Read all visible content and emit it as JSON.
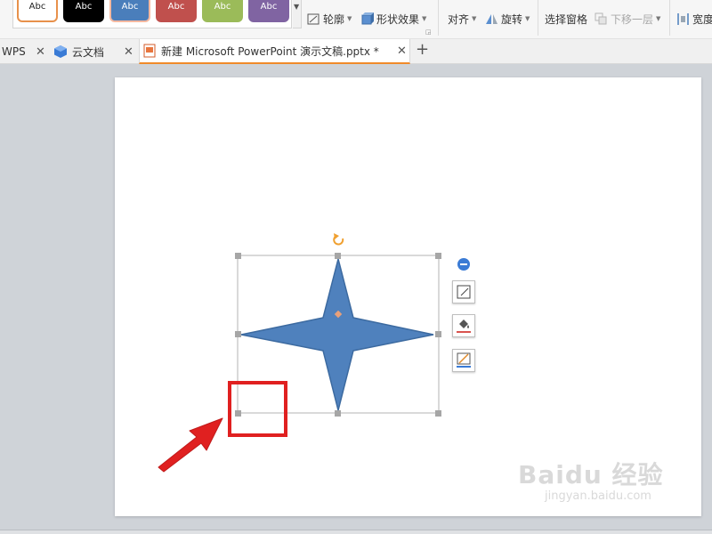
{
  "ribbon": {
    "style_presets": [
      {
        "label": "Abc",
        "color": "#ffffff"
      },
      {
        "label": "Abc",
        "color": "#000000"
      },
      {
        "label": "Abc",
        "color": "#4a7ebb"
      },
      {
        "label": "Abc",
        "color": "#c0504d"
      },
      {
        "label": "Abc",
        "color": "#9bbb59"
      },
      {
        "label": "Abc",
        "color": "#8064a2"
      }
    ],
    "outline_label": "轮廓",
    "effects_label": "形状效果",
    "align_label": "对齐",
    "rotate_label": "旋转",
    "selection_pane_label": "选择窗格",
    "send_backward_label": "下移一层",
    "width_label": "宽度"
  },
  "tabs": [
    {
      "label": "WPS",
      "active": false
    },
    {
      "label": "云文档",
      "active": false
    },
    {
      "label": "新建 Microsoft PowerPoint 演示文稿.pptx *",
      "active": true
    }
  ],
  "shape": {
    "type": "four-point-star",
    "fill": "#4f81bd",
    "stroke": "#3c6aa0",
    "handle_color": "#a6a6a6",
    "rotate_handle_color": "#f0a030",
    "adjust_handle_color": "#e8a07a"
  },
  "annotation": {
    "highlight_color": "#e02020",
    "arrow_color": "#e02020"
  },
  "watermark": {
    "brand": "Baidu 经验",
    "url": "jingyan.baidu.com"
  }
}
